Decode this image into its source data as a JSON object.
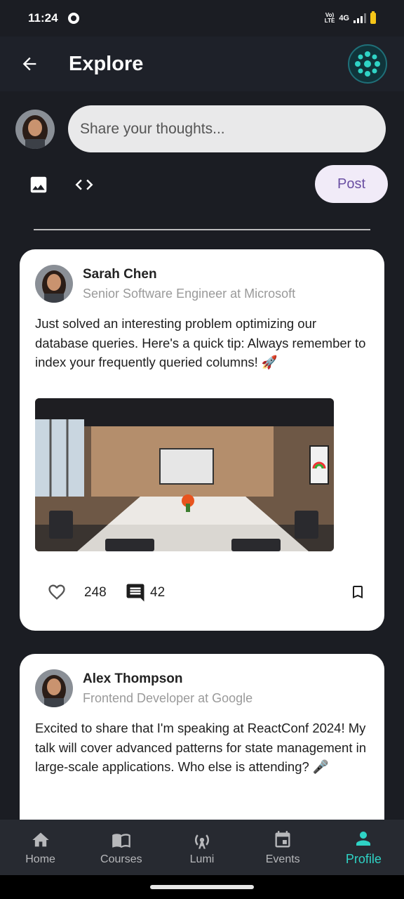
{
  "status_bar": {
    "time": "11:24",
    "network": "4G",
    "volte_top": "Vo)",
    "volte_bottom": "LTE"
  },
  "app_bar": {
    "title": "Explore",
    "back_icon": "arrow-back-icon",
    "logo_icon": "app-logo-icon"
  },
  "composer": {
    "placeholder": "Share your thoughts...",
    "post_label": "Post",
    "image_icon": "image-icon",
    "code_icon": "code-icon"
  },
  "posts": [
    {
      "author": "Sarah Chen",
      "role": "Senior Software Engineer at Microsoft",
      "text": "Just solved an interesting problem optimizing our database queries. Here's a quick tip: Always remember to index your frequently queried columns! 🚀",
      "likes": "248",
      "comments": "42",
      "image": "conference-room-photo"
    },
    {
      "author": "Alex Thompson",
      "role": "Frontend Developer at Google",
      "text": "Excited to share that I'm speaking at ReactConf 2024! My talk will cover advanced patterns for state management in large-scale applications. Who else is attending? 🎤"
    }
  ],
  "bottom_nav": {
    "items": [
      {
        "label": "Home",
        "icon": "home-icon"
      },
      {
        "label": "Courses",
        "icon": "book-icon"
      },
      {
        "label": "Lumi",
        "icon": "broadcast-icon"
      },
      {
        "label": "Events",
        "icon": "calendar-icon"
      },
      {
        "label": "Profile",
        "icon": "person-icon"
      }
    ],
    "active": "Profile"
  },
  "colors": {
    "background": "#1b1d23",
    "accent": "#2fd3c5",
    "post_button_text": "#6a4fa3"
  }
}
